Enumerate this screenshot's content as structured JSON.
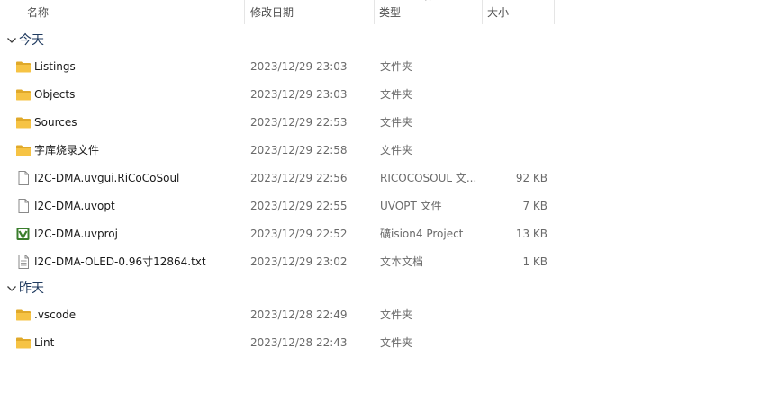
{
  "columns": {
    "name": "名称",
    "date": "修改日期",
    "type": "类型",
    "size": "大小"
  },
  "groups": [
    {
      "label": "今天",
      "rows": [
        {
          "name": "Listings",
          "date": "2023/12/29 23:03",
          "type": "文件夹",
          "size": "",
          "icon": "folder-icon"
        },
        {
          "name": "Objects",
          "date": "2023/12/29 23:03",
          "type": "文件夹",
          "size": "",
          "icon": "folder-icon"
        },
        {
          "name": "Sources",
          "date": "2023/12/29 22:53",
          "type": "文件夹",
          "size": "",
          "icon": "folder-icon"
        },
        {
          "name": "字库烧录文件",
          "date": "2023/12/29 22:58",
          "type": "文件夹",
          "size": "",
          "icon": "folder-icon"
        },
        {
          "name": "I2C-DMA.uvgui.RiCoCoSoul",
          "date": "2023/12/29 22:56",
          "type": "RICOCOSOUL 文...",
          "size": "92 KB",
          "icon": "file-icon"
        },
        {
          "name": "I2C-DMA.uvopt",
          "date": "2023/12/29 22:55",
          "type": "UVOPT 文件",
          "size": "7 KB",
          "icon": "file-icon"
        },
        {
          "name": "I2C-DMA.uvproj",
          "date": "2023/12/29 22:52",
          "type": "礦ision4 Project",
          "size": "13 KB",
          "icon": "keil-project-icon"
        },
        {
          "name": "I2C-DMA-OLED-0.96寸12864.txt",
          "date": "2023/12/29 23:02",
          "type": "文本文档",
          "size": "1 KB",
          "icon": "text-file-icon"
        }
      ]
    },
    {
      "label": "昨天",
      "rows": [
        {
          "name": ".vscode",
          "date": "2023/12/28 22:49",
          "type": "文件夹",
          "size": "",
          "icon": "folder-icon"
        },
        {
          "name": "Lint",
          "date": "2023/12/28 22:43",
          "type": "文件夹",
          "size": "",
          "icon": "folder-icon"
        }
      ]
    }
  ],
  "colors": {
    "folder": "#f6c344",
    "folder_dark": "#e0a92a",
    "group_label": "#1f3a5f",
    "keil_green": "#3a7d2c"
  }
}
